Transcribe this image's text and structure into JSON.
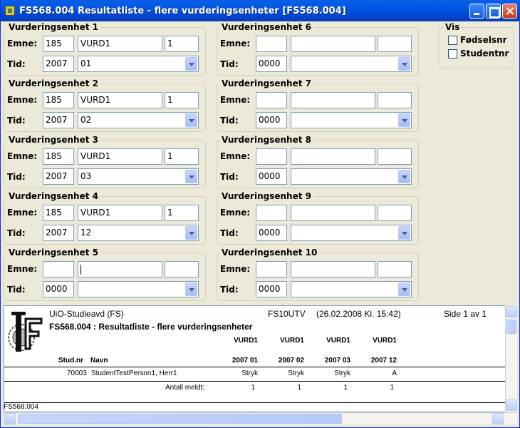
{
  "window": {
    "title": "FS568.004 Resultatliste - flere vurderingsenheter [FS568.004]"
  },
  "labels": {
    "emne": "Emne:",
    "tid": "Tid:"
  },
  "groups": [
    {
      "title": "Vurderingsenhet 1",
      "emne_nr": "185",
      "emne_kode": "VURD1",
      "versjon": "1",
      "aar": "2007",
      "tid": "01"
    },
    {
      "title": "Vurderingsenhet 2",
      "emne_nr": "185",
      "emne_kode": "VURD1",
      "versjon": "1",
      "aar": "2007",
      "tid": "02"
    },
    {
      "title": "Vurderingsenhet 3",
      "emne_nr": "185",
      "emne_kode": "VURD1",
      "versjon": "1",
      "aar": "2007",
      "tid": "03"
    },
    {
      "title": "Vurderingsenhet 4",
      "emne_nr": "185",
      "emne_kode": "VURD1",
      "versjon": "1",
      "aar": "2007",
      "tid": "12"
    },
    {
      "title": "Vurderingsenhet 5",
      "emne_nr": "",
      "emne_kode": "",
      "versjon": "",
      "aar": "0000",
      "tid": ""
    },
    {
      "title": "Vurderingsenhet 6",
      "emne_nr": "",
      "emne_kode": "",
      "versjon": "",
      "aar": "0000",
      "tid": ""
    },
    {
      "title": "Vurderingsenhet 7",
      "emne_nr": "",
      "emne_kode": "",
      "versjon": "",
      "aar": "0000",
      "tid": ""
    },
    {
      "title": "Vurderingsenhet 8",
      "emne_nr": "",
      "emne_kode": "",
      "versjon": "",
      "aar": "0000",
      "tid": ""
    },
    {
      "title": "Vurderingsenhet 9",
      "emne_nr": "",
      "emne_kode": "",
      "versjon": "",
      "aar": "0000",
      "tid": ""
    },
    {
      "title": "Vurderingsenhet 10",
      "emne_nr": "",
      "emne_kode": "",
      "versjon": "",
      "aar": "0000",
      "tid": ""
    }
  ],
  "vis": {
    "title": "Vis",
    "options": [
      {
        "label": "Fødselsnr",
        "checked": false
      },
      {
        "label": "Studentnr",
        "checked": false
      }
    ]
  },
  "report": {
    "org": "UiO-Studieavd (FS)",
    "system": "FS10UTV",
    "timestamp": "(26.02.2008 Kl. 15:42)",
    "page": "Side 1 av 1",
    "title": "FS568.004 : Resultatliste - flere vurderingsenheter",
    "col_studnr": "Stud.nr",
    "col_navn": "Navn",
    "columns": [
      {
        "emne": "VURD1",
        "tid": "2007 01"
      },
      {
        "emne": "VURD1",
        "tid": "2007 02"
      },
      {
        "emne": "VURD1",
        "tid": "2007 03"
      },
      {
        "emne": "VURD1",
        "tid": "2007 12"
      }
    ],
    "rows": [
      {
        "studnr": "70003",
        "navn": "StudentTestPerson1, Herr1",
        "results": [
          "Stryk",
          "Stryk",
          "Stryk",
          "A"
        ]
      }
    ],
    "sum_label": "Antall meldt:",
    "sums": [
      "1",
      "1",
      "1",
      "1"
    ]
  },
  "statusbar": {
    "text": "FS568.004"
  }
}
